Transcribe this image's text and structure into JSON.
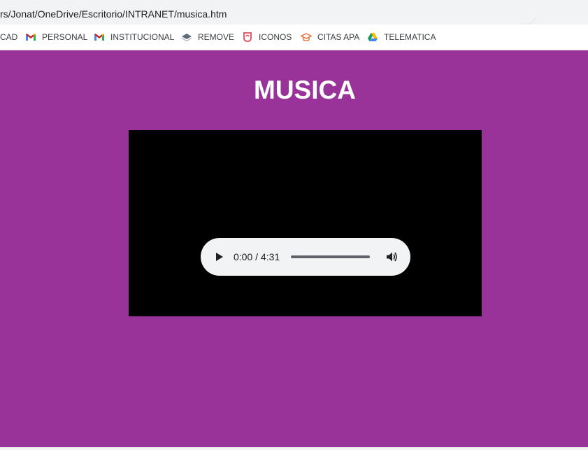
{
  "browser": {
    "address": "rs/Jonat/OneDrive/Escritorio/INTRANET/musica.htm",
    "bookmarks": [
      {
        "label": "CAD",
        "icon": "none"
      },
      {
        "label": "PERSONAL",
        "icon": "gmail-icon"
      },
      {
        "label": "INSTITUCIONAL",
        "icon": "gmail-icon"
      },
      {
        "label": "REMOVE",
        "icon": "layers-icon"
      },
      {
        "label": "ICONOS",
        "icon": "flaticon-icon"
      },
      {
        "label": "CITAS APA",
        "icon": "graduation-cap-icon"
      },
      {
        "label": "TELEMATICA",
        "icon": "drive-icon"
      }
    ]
  },
  "page": {
    "title": "MUSICA",
    "background_color": "#993399"
  },
  "player": {
    "time": "0:00 / 4:31",
    "progress": 0,
    "play_icon": "play-icon",
    "volume_icon": "volume-icon"
  }
}
